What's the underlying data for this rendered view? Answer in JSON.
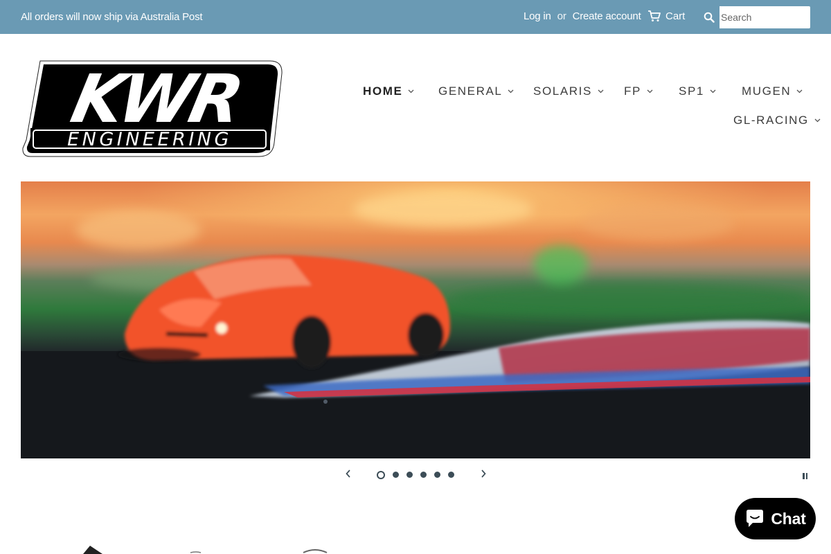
{
  "topbar": {
    "announcement": "All orders will now ship via Australia Post",
    "login": "Log in",
    "or": "or",
    "create_account": "Create account",
    "cart": "Cart",
    "search_placeholder": "Search"
  },
  "logo": {
    "line1": "KWR",
    "line2": "ENGINEERING"
  },
  "nav": {
    "items": [
      {
        "label": "HOME",
        "active": true
      },
      {
        "label": "GENERAL"
      },
      {
        "label": "SOLARIS"
      },
      {
        "label": "FP"
      },
      {
        "label": "SP1"
      },
      {
        "label": "MUGEN"
      },
      {
        "label": "GL-RACING"
      }
    ]
  },
  "slider": {
    "current_slide": 1,
    "slide_count": 6
  },
  "chat": {
    "label": "Chat"
  },
  "colors": {
    "topbar": "#6a9ab4",
    "dark": "#3c4d57",
    "chat_bg": "#000000"
  }
}
